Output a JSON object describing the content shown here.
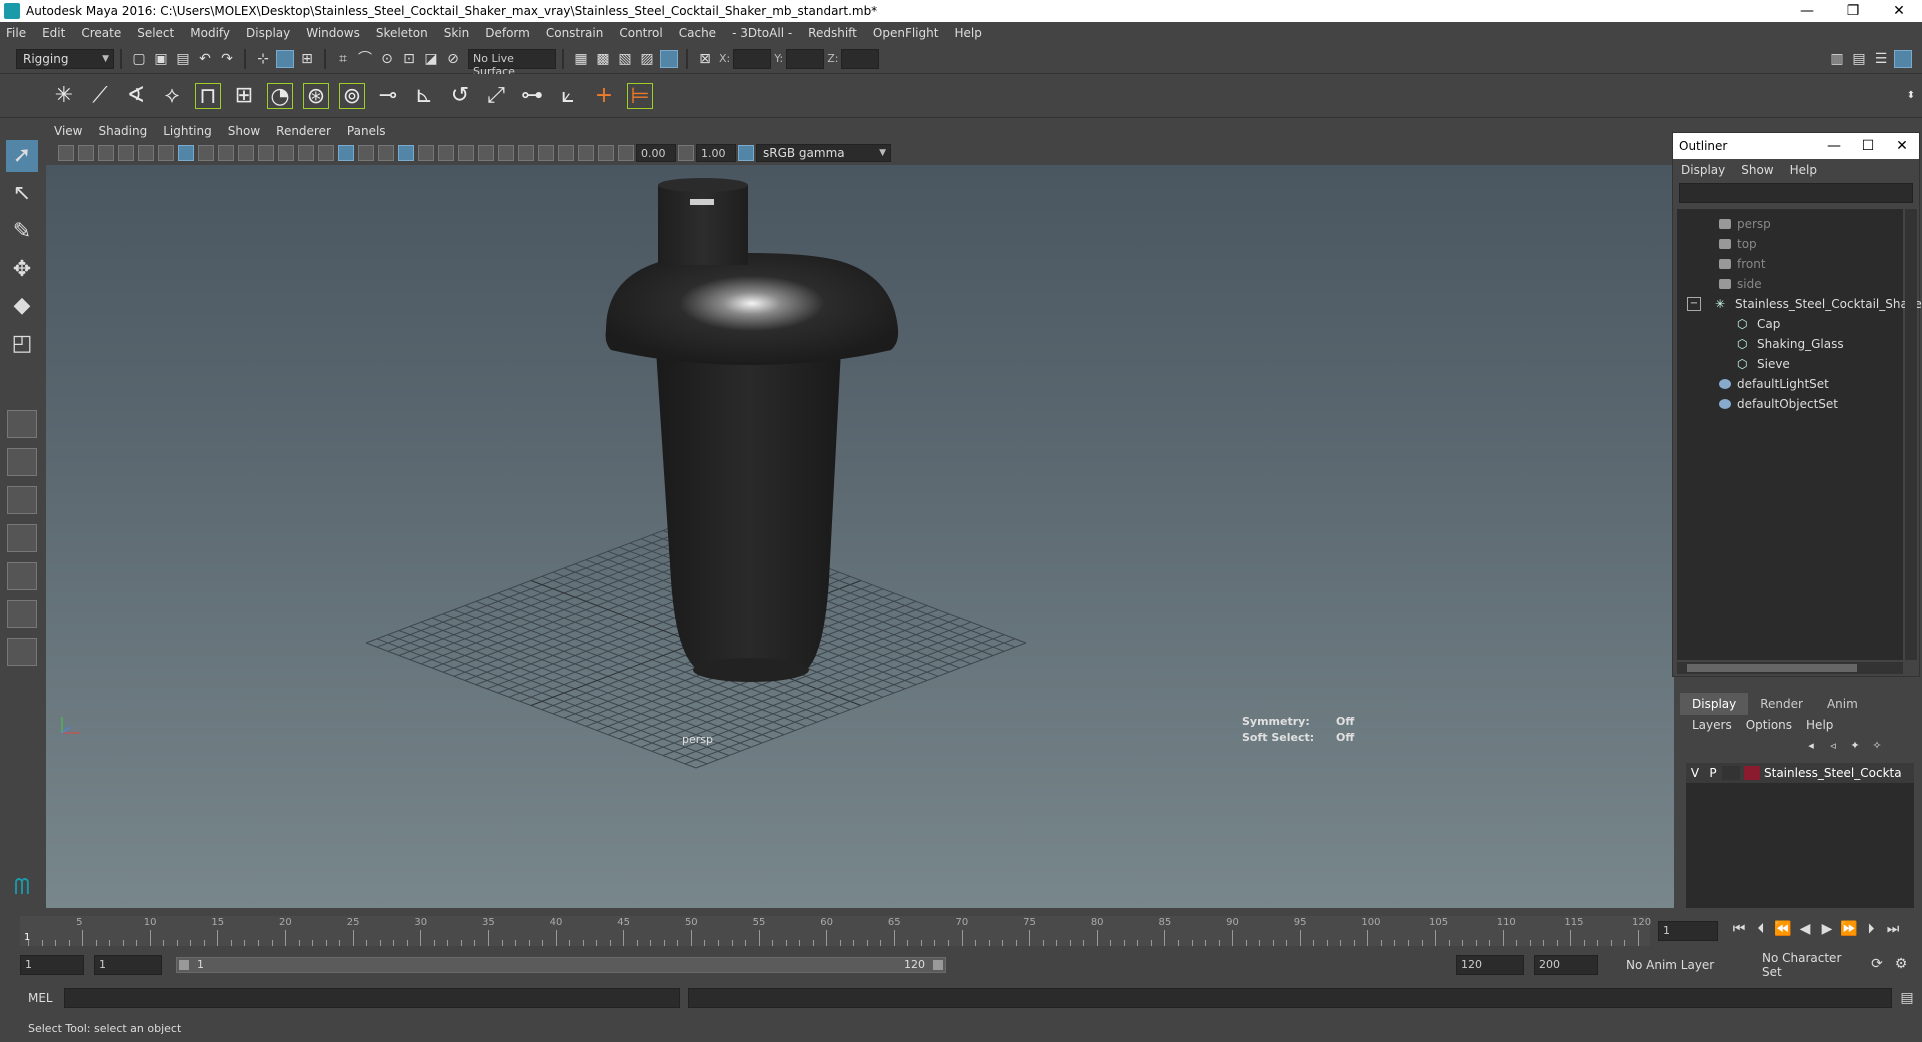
{
  "window": {
    "title": "Autodesk Maya 2016: C:\\Users\\MOLEX\\Desktop\\Stainless_Steel_Cocktail_Shaker_max_vray\\Stainless_Steel_Cocktail_Shaker_mb_standart.mb*",
    "minimize": "—",
    "restore": "❐",
    "close": "✕"
  },
  "menubar": [
    "File",
    "Edit",
    "Create",
    "Select",
    "Modify",
    "Display",
    "Windows",
    "Skeleton",
    "Skin",
    "Deform",
    "Constrain",
    "Control",
    "Cache",
    "- 3DtoAll -",
    "Redshift",
    "OpenFlight",
    "Help"
  ],
  "statusline": {
    "menu_set": "Rigging",
    "live_surface": "No Live Surface",
    "x_label": "X:",
    "y_label": "Y:",
    "z_label": "Z:"
  },
  "panel_menu": [
    "View",
    "Shading",
    "Lighting",
    "Show",
    "Renderer",
    "Panels"
  ],
  "panel_tools": {
    "exposure": "0.00",
    "gamma": "1.00",
    "color_space": "sRGB gamma"
  },
  "viewport": {
    "camera_label": "persp",
    "symmetry_label": "Symmetry:",
    "symmetry_value": "Off",
    "soft_select_label": "Soft Select:",
    "soft_select_value": "Off"
  },
  "outliner": {
    "title": "Outliner",
    "menu": [
      "Display",
      "Show",
      "Help"
    ],
    "items": [
      {
        "label": "persp",
        "kind": "camera"
      },
      {
        "label": "top",
        "kind": "camera"
      },
      {
        "label": "front",
        "kind": "camera"
      },
      {
        "label": "side",
        "kind": "camera"
      },
      {
        "label": "Stainless_Steel_Cocktail_Shaker_",
        "kind": "group"
      },
      {
        "label": "Cap",
        "kind": "mesh"
      },
      {
        "label": "Shaking_Glass",
        "kind": "mesh"
      },
      {
        "label": "Sieve",
        "kind": "mesh"
      },
      {
        "label": "defaultLightSet",
        "kind": "set"
      },
      {
        "label": "defaultObjectSet",
        "kind": "set"
      }
    ]
  },
  "layer_editor": {
    "tabs": [
      "Display",
      "Render",
      "Anim"
    ],
    "menu": [
      "Layers",
      "Options",
      "Help"
    ],
    "layer": {
      "v": "V",
      "p": "P",
      "name": "Stainless_Steel_Cockta",
      "color": "#8a1a2e"
    }
  },
  "timeline": {
    "ticks": [
      "5",
      "10",
      "15",
      "20",
      "25",
      "30",
      "35",
      "40",
      "45",
      "50",
      "55",
      "60",
      "65",
      "70",
      "75",
      "80",
      "85",
      "90",
      "95",
      "100",
      "105",
      "110",
      "115",
      "120"
    ],
    "current_frame": "1",
    "frame_field": "1"
  },
  "range": {
    "start": "1",
    "playback_start": "1",
    "range_start_label": "1",
    "range_end_label": "120",
    "playback_end": "120",
    "end": "200",
    "anim_layer": "No Anim Layer",
    "character_set": "No Character Set"
  },
  "cmdline": {
    "label": "MEL"
  },
  "helpline": {
    "text": "Select Tool: select an object"
  }
}
